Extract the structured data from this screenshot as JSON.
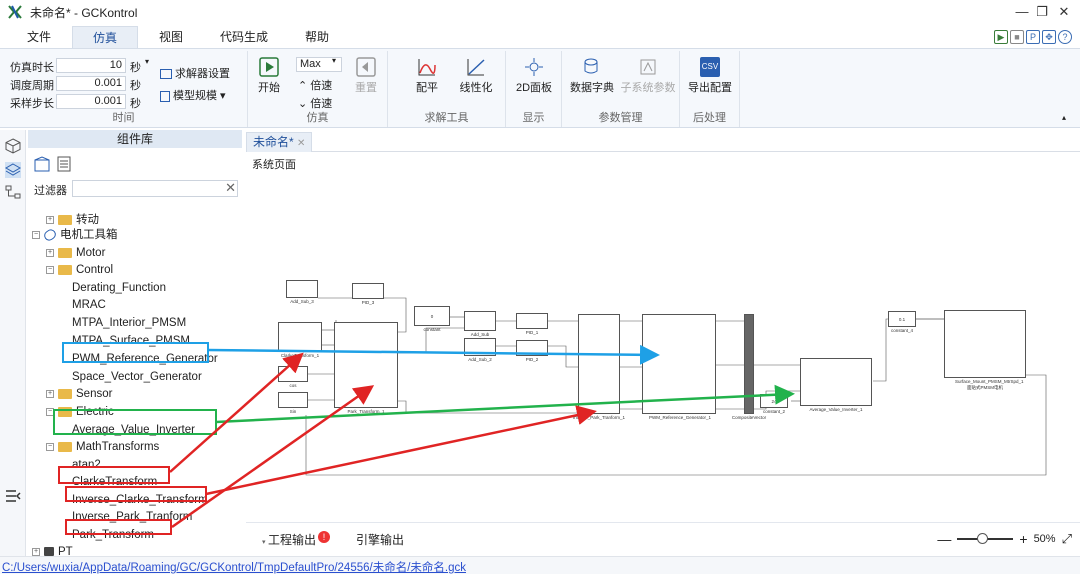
{
  "window": {
    "title": "未命名* - GCKontrol",
    "minimize": "—",
    "restore": "❐",
    "close": "✕"
  },
  "menu": [
    "文件",
    "仿真",
    "视图",
    "代码生成",
    "帮助"
  ],
  "ribbon": {
    "time_group": {
      "label": "时间",
      "sim_duration_label": "仿真时长",
      "sim_duration_value": "10",
      "sim_duration_unit": "秒",
      "schedule_label": "调度周期",
      "schedule_value": "0.001",
      "schedule_unit": "秒",
      "sample_label": "采样步长",
      "sample_value": "0.001",
      "sample_unit": "秒"
    },
    "solver_settings": "求解器设置",
    "model_scale": "模型规模",
    "sim_group": {
      "label": "仿真",
      "start": "开始",
      "speed_value": "Max",
      "speed_up": "倍速",
      "speed_down": "倍速",
      "reset": "重置"
    },
    "solve_group": {
      "label": "求解工具",
      "trim": "配平",
      "linearize": "线性化"
    },
    "display_group": {
      "label": "显示",
      "panel2d": "2D面板"
    },
    "param_group": {
      "label": "参数管理",
      "data_dict": "数据字典",
      "subsys_params": "子系统参数"
    },
    "post_group": {
      "label": "后处理",
      "export": "导出配置",
      "csv": "CSV"
    }
  },
  "library": {
    "header": "组件库",
    "filter_label": "过滤器",
    "filter_value": "",
    "items": [
      {
        "label": "转动",
        "type": "folder",
        "level": 1
      },
      {
        "label": "电机工具箱",
        "type": "toolbox",
        "level": 0
      },
      {
        "label": "Motor",
        "type": "folder",
        "level": 1
      },
      {
        "label": "Control",
        "type": "folder",
        "level": 1
      },
      {
        "label": "Derating_Function",
        "type": "leaf",
        "level": 2
      },
      {
        "label": "MRAC",
        "type": "leaf",
        "level": 2
      },
      {
        "label": "MTPA_Interior_PMSM",
        "type": "leaf",
        "level": 2
      },
      {
        "label": "MTPA_Surface_PMSM",
        "type": "leaf",
        "level": 2
      },
      {
        "label": "PWM_Reference_Generator",
        "type": "leaf",
        "level": 2
      },
      {
        "label": "Space_Vector_Generator",
        "type": "leaf",
        "level": 2
      },
      {
        "label": "Sensor",
        "type": "folder",
        "level": 1
      },
      {
        "label": "Electric",
        "type": "folder",
        "level": 1
      },
      {
        "label": "Average_Value_Inverter",
        "type": "leaf",
        "level": 2
      },
      {
        "label": "MathTransforms",
        "type": "folder",
        "level": 1
      },
      {
        "label": "atan2",
        "type": "leaf",
        "level": 2
      },
      {
        "label": "ClarkeTransform",
        "type": "leaf",
        "level": 2
      },
      {
        "label": "Inverse_Clarke_Transform",
        "type": "leaf",
        "level": 2
      },
      {
        "label": "Inverse_Park_Tranform",
        "type": "leaf",
        "level": 2
      },
      {
        "label": "Park_Transform",
        "type": "leaf",
        "level": 2
      },
      {
        "label": "PT",
        "type": "lock",
        "level": 0
      }
    ]
  },
  "canvas": {
    "tab": "未命名*",
    "page": "系统页面",
    "blocks": {
      "add_sub3": "Add_Sub_3",
      "pid3": "PID_3",
      "constant": "constant",
      "add_sub": "Add_Sub",
      "pid1": "PID_1",
      "add_sub2": "Add_Sub_2",
      "pid2": "PID_2",
      "clarke1": "ClarkeTransform_1",
      "park1": "Park_Transform_1",
      "cos": "cos",
      "sin": "Sin",
      "invpark1": "Inverse_Park_Tranform_1",
      "pwm1": "PWM_Reference_Generator_1",
      "composite": "CompositeVector",
      "constant2": "constant_2",
      "avi1": "Average_Value_Inverter_1",
      "constant4": "constant_4",
      "pmsm": "Surface_Mount_PMSM_MtrSpd_1",
      "pmsm_sub": "面贴式PMSM电机",
      "const_val": "0",
      "const2_val": "24",
      "const4_val": "0.1"
    }
  },
  "output": {
    "project": "工程输出",
    "badge": "!",
    "engine": "引擎输出",
    "zoom": "50%"
  },
  "status": {
    "path": "C:/Users/wuxia/AppData/Roaming/GC/GCKontrol/TmpDefaultPro/24556/未命名/未命名.gck"
  }
}
